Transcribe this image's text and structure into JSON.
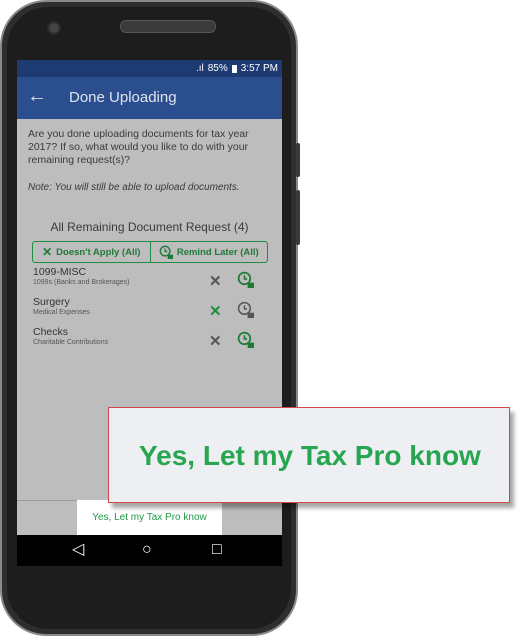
{
  "status": {
    "signal": ".ıl",
    "battery": "85%",
    "time": "3:57 PM"
  },
  "appbar": {
    "back_icon": "←",
    "title": "Done Uploading"
  },
  "question": "Are you done uploading documents for tax year 2017? If so, what would you like to do with your remaining request(s)?",
  "note": "Note: You will still be able to upload documents.",
  "section_title": "All Remaining Document Request (4)",
  "bulk": {
    "doesnt_apply_label": "Doesn't Apply (All)",
    "remind_later_label": "Remind Later (All)"
  },
  "requests": [
    {
      "title": "1099-MISC",
      "subtitle": "1099s (Banks and Brokerages)",
      "x_color": "#555555"
    },
    {
      "title": "Surgery",
      "subtitle": "Medical Expenses",
      "x_color": "#1f8d3e"
    },
    {
      "title": "Checks",
      "subtitle": "Charitable Contributions",
      "x_color": "#555555"
    }
  ],
  "confirm_button": "Yes, Let my Tax Pro know",
  "callout_text": "Yes, Let my Tax Pro know",
  "nav": {
    "back": "◁",
    "home": "○",
    "recents": "□"
  },
  "colors": {
    "appbar": "#2b4e8f",
    "accent_green": "#1f8d3e"
  }
}
